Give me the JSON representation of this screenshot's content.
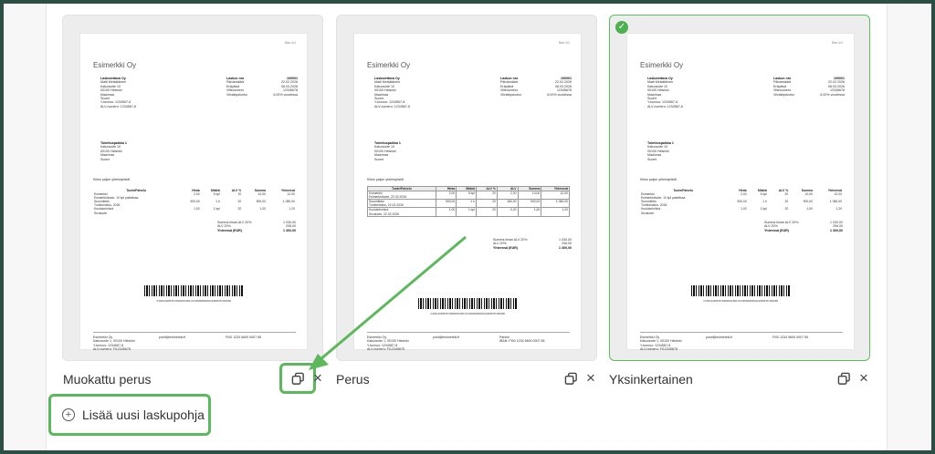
{
  "templates": [
    {
      "name": "Muokattu perus",
      "invoice": {
        "page": "Sivu 1/1",
        "company": "Esimerkki Oy",
        "customer": {
          "name": "Laskutettava Oy",
          "lines": [
            "Matti Meikäläinen",
            "Katuosoite 10",
            "00100 Helsinki",
            "Maa/maa",
            "Suomi",
            "Y-tunnus: 1234567-8",
            "ALV-numero: 1234567-8"
          ]
        },
        "meta": [
          [
            "Laskun nro",
            "100001"
          ],
          [
            "Päivämäärä",
            "22.02.2026"
          ],
          [
            "Eräpäivä",
            "08.03.2026"
          ],
          [
            "Viitenumero",
            "12345678"
          ],
          [
            "Viivästyskorko",
            "8,00% vuodessa"
          ]
        ],
        "recipient": {
          "name": "Toimituspaikka 1",
          "lines": [
            "Katuosoite 10",
            "00100 Helsinki",
            "Maa/maa",
            "Suomi"
          ]
        },
        "intro": "Kiitos paljon yhteistyöstä!",
        "headers": [
          "Tuote/Palvelu",
          "Hinta",
          "Määrä",
          "ALV %",
          "Summa",
          "Yhteensä"
        ],
        "rows": [
          [
            "Esimerkki",
            "Esimerkkituote, 10 kpl paketissa",
            "2,00",
            "5 kpl",
            "20",
            "10,00",
            "12,00"
          ],
          [
            "Suunnittelu",
            "Tuntiveloitus, 2026",
            "900,00",
            "1 h",
            "20",
            "900,00",
            "1 080,00"
          ],
          [
            "Kuulokelohkot",
            "Sivutuote",
            "1,00",
            "1 kpl",
            "20",
            "1,00",
            "1,20"
          ]
        ],
        "totals": [
          [
            "Summa ilman ALV 20%",
            "1 030,00"
          ],
          [
            "ALV 20%",
            "206,00"
          ],
          [
            "Yhteensä (EUR)",
            "1 300,00"
          ]
        ],
        "barnum": "4 00012345678 00000001300 00 0000000000012345678 260308",
        "footer": {
          "c1": [
            "Esimerkki Oy",
            "Katuosoite 1, 00100 Helsinki",
            "Y-tunnus: 1234567-8",
            "ALV-numero: FI12345678"
          ],
          "c2": [
            "posti@esimerkki.fi"
          ],
          "c3": [
            "FI00 1234 5600 0007 85"
          ]
        }
      }
    },
    {
      "name": "Perus",
      "invoice": {
        "page": "Sivu 1/1",
        "company": "Esimerkki Oy",
        "customer": {
          "name": "Laskutettava Oy",
          "lines": [
            "Matti Meikäläinen",
            "Katuosoite 10",
            "00100 Helsinki",
            "Maa/maa",
            "Suomi",
            "Y-tunnus: 1234567-8",
            "ALV-numero: 1234567-8"
          ]
        },
        "meta": [
          [
            "Laskun nro",
            "100001"
          ],
          [
            "Päivämäärä",
            "22.02.2026"
          ],
          [
            "Eräpäivä",
            "08.03.2026"
          ],
          [
            "Viitenumero",
            "12345678"
          ],
          [
            "Viivästyskorko",
            "8,00% vuodessa"
          ]
        ],
        "recipient": {
          "name": "Toimituspaikka 1",
          "lines": [
            "Katuosoite 10",
            "00100 Helsinki",
            "Maa/maa",
            "Suomi"
          ]
        },
        "intro": "Kiitos paljon yhteistyöstä!",
        "headers": [
          "Tuote/Palvelu",
          "Hinta",
          "Määrä",
          "ALV %",
          "ALV",
          "Summa",
          "Yhteensä"
        ],
        "rows": [
          [
            "Esimerkki",
            "Esimerkkituote, 22.02.2026",
            "2,00",
            "5 kpl",
            "20",
            "2,00",
            "10,00",
            "12,00"
          ],
          [
            "Suunnittelu",
            "Tuntiveloitus, 22.02.2026",
            "900,00",
            "1 h",
            "20",
            "180,00",
            "900,00",
            "1 080,00"
          ],
          [
            "Kuulokelohkot",
            "Sivutuote, 22.02.2026",
            "1,00",
            "1 kpl",
            "20",
            "0,20",
            "1,00",
            "1,20"
          ]
        ],
        "totals": [
          [
            "Summa ilman ALV 20%",
            "1 030,00"
          ],
          [
            "ALV 20%",
            "206,00"
          ],
          [
            "Yhteensä (EUR)",
            "1 300,00"
          ]
        ],
        "barnum": "4 00012345678 00000001300 00 0000000000012345678 260308",
        "footer": {
          "c1": [
            "Esimerkki Oy",
            "Katuosoite 1, 00100 Helsinki",
            "Y-tunnus: 1234567-8",
            "ALV-numero: FI12345678"
          ],
          "c2": [
            "posti@esimerkki.fi"
          ],
          "c3": [
            "Pankki",
            "IBAN: FI00 1234 5600 0007 85"
          ]
        }
      }
    },
    {
      "name": "Yksinkertainen",
      "selected": true,
      "invoice": {
        "page": "Sivu 1/1",
        "company": "Esimerkki Oy",
        "customer": {
          "name": "Laskutettava Oy",
          "lines": [
            "Matti Meikäläinen",
            "Katuosoite 10",
            "00100 Helsinki",
            "Maa/maa",
            "Suomi",
            "Y-tunnus: 1234567-8",
            "ALV-numero: 1234567-8"
          ]
        },
        "meta": [
          [
            "Laskun nro",
            "100001"
          ],
          [
            "Päivämäärä",
            "22.02.2026"
          ],
          [
            "Eräpäivä",
            "08.03.2026"
          ],
          [
            "Viitenumero",
            "12345678"
          ],
          [
            "Viivästyskorko",
            "8,00% vuodessa"
          ]
        ],
        "recipient": {
          "name": "Toimituspaikka 1",
          "lines": [
            "Katuosoite 10",
            "00100 Helsinki",
            "Maa/maa",
            "Suomi"
          ]
        },
        "intro": "Kiitos paljon yhteistyöstä!",
        "headers": [
          "Tuote/Palvelu",
          "Hinta",
          "Määrä",
          "ALV %",
          "Summa",
          "Yhteensä"
        ],
        "rows": [
          [
            "Esimerkki",
            "Esimerkkituote, 10 kpl paketissa",
            "2,00",
            "5 kpl",
            "20",
            "10,00",
            "12,00"
          ],
          [
            "Suunnittelu",
            "Tuntiveloitus, 2026",
            "900,00",
            "1 h",
            "20",
            "900,00",
            "1 080,00"
          ],
          [
            "Kuulokelohkot",
            "Sivutuote",
            "1,00",
            "1 kpl",
            "20",
            "1,00",
            "1,20"
          ]
        ],
        "totals": [
          [
            "Summa ilman ALV 20%",
            "1 030,00"
          ],
          [
            "ALV 20%",
            "206,00"
          ],
          [
            "Yhteensä (EUR)",
            "1 300,00"
          ]
        ],
        "barnum": "4 00012345678 00000001300 00 0000000000012345678 260308",
        "footer": {
          "c1": [
            "Esimerkki Oy",
            "Katuosoite 1, 00100 Helsinki",
            "Y-tunnus: 1234567-8",
            "ALV-numero: FI12345678"
          ],
          "c2": [
            "posti@esimerkki.fi"
          ],
          "c3": [
            "FI00 1234 5600 0007 85"
          ]
        }
      }
    }
  ],
  "add_template_label": "Lisää uusi laskupohja",
  "check_glyph": "✓",
  "close_glyph": "×",
  "plus_glyph": "+",
  "colors": {
    "highlight": "#5cb85c",
    "selected_border": "#5bbf5b",
    "frame": "#2b4f45"
  }
}
